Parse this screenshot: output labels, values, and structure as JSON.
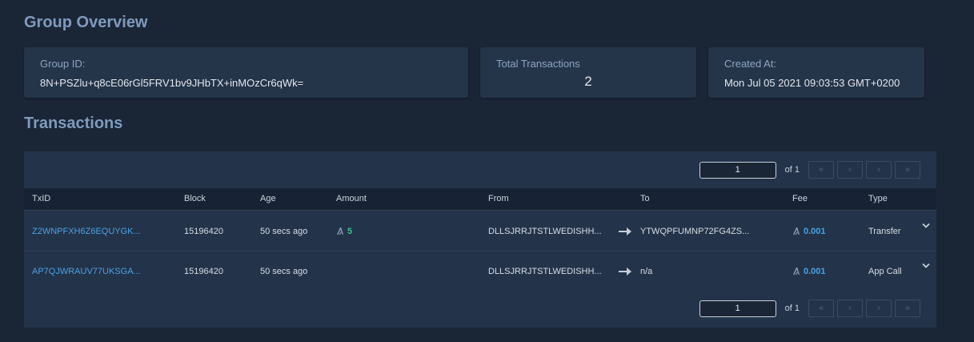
{
  "overview": {
    "title": "Group Overview",
    "group_id_label": "Group ID:",
    "group_id_value": "8N+PSZlu+q8cE06rGl5FRV1bv9JHbTX+inMOzCr6qWk=",
    "total_tx_label": "Total Transactions",
    "total_tx_value": "2",
    "created_label": "Created At:",
    "created_value": "Mon Jul 05 2021 09:03:53 GMT+0200"
  },
  "transactions": {
    "title": "Transactions",
    "pager": {
      "page": "1",
      "of_label": "of 1",
      "first": "«",
      "prev": "‹",
      "next": "›",
      "last": "»"
    },
    "columns": {
      "txid": "TxID",
      "block": "Block",
      "age": "Age",
      "amount": "Amount",
      "from": "From",
      "to": "To",
      "fee": "Fee",
      "type": "Type"
    },
    "rows": [
      {
        "txid": "Z2WNPFXH6Z6EQUYGK...",
        "block": "15196420",
        "age": "50 secs ago",
        "amount": "5",
        "from": "DLLSJRRJTSTLWEDISHH...",
        "to": "YTWQPFUMNP72FG4ZS...",
        "fee": "0.001",
        "type": "Transfer"
      },
      {
        "txid": "AP7QJWRAUV77UKSGA...",
        "block": "15196420",
        "age": "50 secs ago",
        "amount": "",
        "from": "DLLSJRRJTSTLWEDISHH...",
        "to": "n/a",
        "fee": "0.001",
        "type": "App Call"
      }
    ]
  },
  "colors": {
    "background": "#1a2536",
    "card": "#243449",
    "heading": "#7f9bbd",
    "link": "#4aa2e6",
    "amount": "#37c38d"
  },
  "icons": {
    "algo": "algo-icon",
    "arrow": "arrow-right-icon",
    "expand": "chevron-down-icon"
  }
}
